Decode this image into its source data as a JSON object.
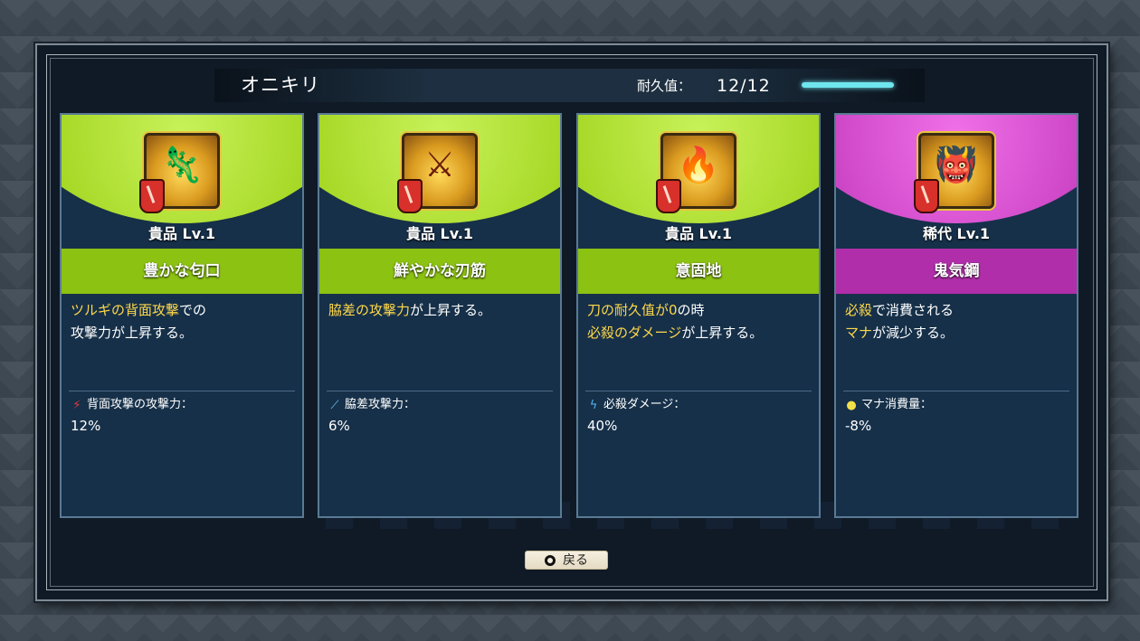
{
  "weapon": {
    "name": "オニキリ",
    "durability_label": "耐久值：",
    "durability_value": "12/12",
    "durability_fraction": 1.0,
    "accent_color": "#6fe6ee"
  },
  "cards": [
    {
      "portrait_icon": "lizard-character-icon",
      "rarity": "貴品 Lv.1",
      "theme": "green",
      "skill_name": "豊かな匂口",
      "desc_line1_hl": "ツルギの背面攻撃",
      "desc_line1_rest": "での",
      "desc_line2_hl": "",
      "desc_line2_rest": "攻撃力が上昇する。",
      "stat_icon": "claw-icon",
      "stat_label": "背面攻撃の攻撃力：",
      "stat_value": "12%"
    },
    {
      "portrait_icon": "samurai-character-icon",
      "rarity": "貴品 Lv.1",
      "theme": "green",
      "skill_name": "鮮やかな刃筋",
      "desc_line1_hl": "脇差の攻撃力",
      "desc_line1_rest": "が上昇する。",
      "desc_line2_hl": "",
      "desc_line2_rest": "",
      "stat_icon": "dagger-icon",
      "stat_label": "脇差攻撃力：",
      "stat_value": "6%"
    },
    {
      "portrait_icon": "flame-warrior-character-icon",
      "rarity": "貴品 Lv.1",
      "theme": "green",
      "skill_name": "意固地",
      "desc_line1_hl": "刀の耐久值が0",
      "desc_line1_rest": "の時",
      "desc_line2_hl": "必殺のダメージ",
      "desc_line2_rest": "が上昇する。",
      "stat_icon": "lightning-icon",
      "stat_label": "必殺ダメージ：",
      "stat_value": "40%"
    },
    {
      "portrait_icon": "oni-character-icon",
      "rarity": "稀代 Lv.1",
      "theme": "purple",
      "skill_name": "鬼気鋼",
      "desc_line1_hl": "必殺",
      "desc_line1_rest": "で消費される",
      "desc_line2_hl": "マナ",
      "desc_line2_rest": "が減少する。",
      "stat_icon": "gourd-icon",
      "stat_label": "マナ消費量：",
      "stat_value": "-8%"
    }
  ],
  "footer": {
    "back_icon": "circle-button-icon",
    "back_label": "戻る"
  }
}
